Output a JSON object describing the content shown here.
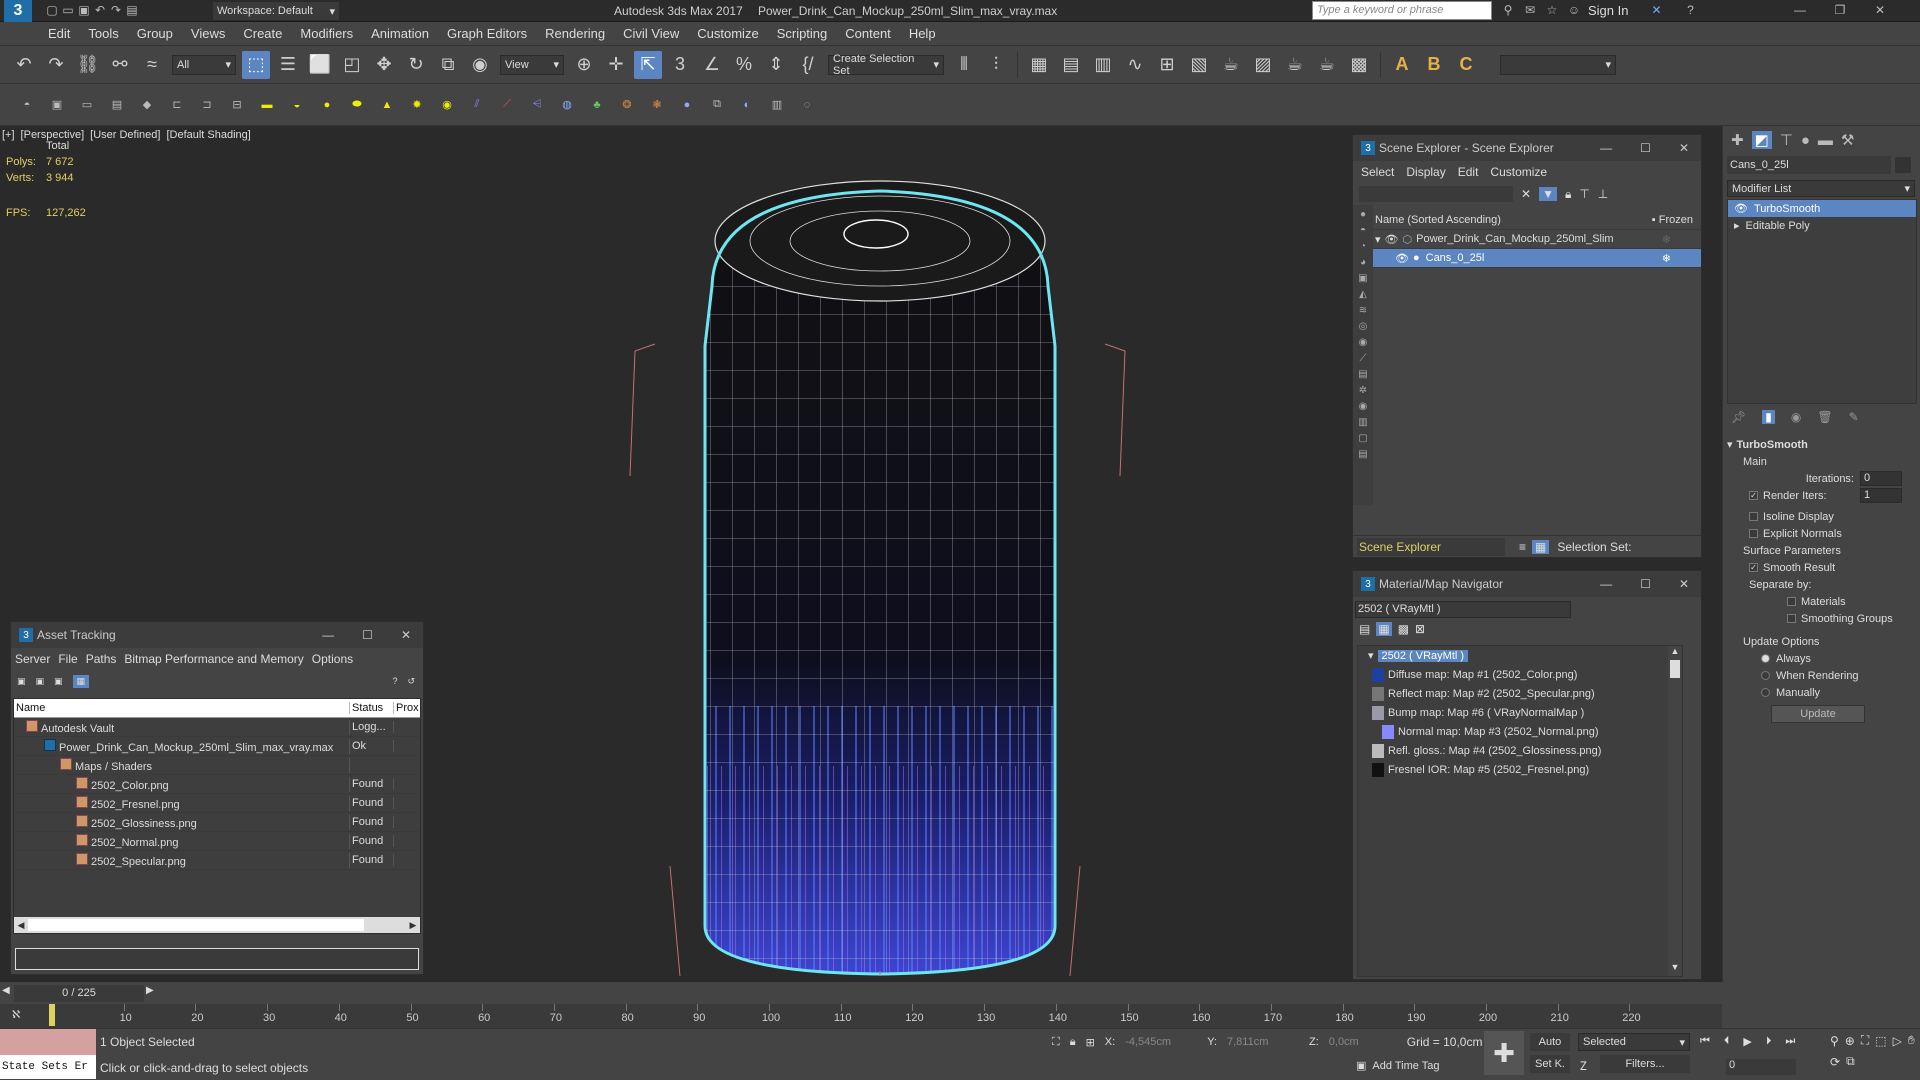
{
  "app": {
    "title": "Autodesk 3ds Max 2017",
    "file": "Power_Drink_Can_Mockup_250ml_Slim_max_vray.max",
    "workspace": "Workspace: Default",
    "search_placeholder": "Type a keyword or phrase",
    "sign_in": "Sign In"
  },
  "menu": [
    "Edit",
    "Tools",
    "Group",
    "Views",
    "Create",
    "Modifiers",
    "Animation",
    "Graph Editors",
    "Rendering",
    "Civil View",
    "Customize",
    "Scripting",
    "Content",
    "Help"
  ],
  "toolbar": {
    "filter": "All",
    "ref_coord": "View",
    "selection_set": "Create Selection Set"
  },
  "viewport": {
    "label_plus": "[+]",
    "label_view": "[Perspective]",
    "label_user": "[User Defined]",
    "label_shading": "[Default Shading]",
    "stats_total": "Total",
    "polys_label": "Polys:",
    "polys_value": "7 672",
    "verts_label": "Verts:",
    "verts_value": "3 944",
    "fps_label": "FPS:",
    "fps_value": "127,262"
  },
  "scene_explorer": {
    "title": "Scene Explorer - Scene Explorer",
    "menu": [
      "Select",
      "Display",
      "Edit",
      "Customize"
    ],
    "col_name": "Name (Sorted Ascending)",
    "col_frozen": "▪ Frozen",
    "items": [
      "Power_Drink_Can_Mockup_250ml_Slim",
      "Cans_0_25l"
    ],
    "footer_left": "Scene Explorer",
    "footer_right": "Selection Set:"
  },
  "material_nav": {
    "title": "Material/Map Navigator",
    "field": "2502  ( VRayMtl )",
    "root": "2502  ( VRayMtl )",
    "items": [
      "Diffuse map: Map #1 (2502_Color.png)",
      "Reflect map: Map #2 (2502_Specular.png)",
      "Bump map: Map #6  ( VRayNormalMap )",
      "Normal map: Map #3 (2502_Normal.png)",
      "Refl. gloss.: Map #4 (2502_Glossiness.png)",
      "Fresnel IOR: Map #5 (2502_Fresnel.png)"
    ]
  },
  "asset_tracking": {
    "title": "Asset Tracking",
    "menu": [
      "Server",
      "File",
      "Paths",
      "Bitmap Performance and Memory",
      "Options"
    ],
    "col_name": "Name",
    "col_status": "Status",
    "col_prox": "Prox",
    "rows": [
      {
        "name": "Autodesk Vault",
        "status": "Logg..."
      },
      {
        "name": "Power_Drink_Can_Mockup_250ml_Slim_max_vray.max",
        "status": "Ok"
      },
      {
        "name": "Maps / Shaders",
        "status": ""
      },
      {
        "name": "2502_Color.png",
        "status": "Found"
      },
      {
        "name": "2502_Fresnel.png",
        "status": "Found"
      },
      {
        "name": "2502_Glossiness.png",
        "status": "Found"
      },
      {
        "name": "2502_Normal.png",
        "status": "Found"
      },
      {
        "name": "2502_Specular.png",
        "status": "Found"
      }
    ]
  },
  "command_panel": {
    "object_name": "Cans_0_25l",
    "modifier_list": "Modifier List",
    "stack": [
      "TurboSmooth",
      "Editable Poly"
    ],
    "rollout": "TurboSmooth",
    "main": "Main",
    "iterations_label": "Iterations:",
    "iterations_value": "0",
    "render_iters_label": "Render Iters:",
    "render_iters_value": "1",
    "isoline": "Isoline Display",
    "explicit": "Explicit Normals",
    "surface_params": "Surface Parameters",
    "smooth_result": "Smooth Result",
    "separate_by": "Separate by:",
    "materials": "Materials",
    "smoothing_groups": "Smoothing Groups",
    "update_options": "Update Options",
    "always": "Always",
    "when_rendering": "When Rendering",
    "manually": "Manually",
    "update_btn": "Update"
  },
  "timeline": {
    "frame": "0 / 225",
    "ticks": [
      "10",
      "20",
      "30",
      "40",
      "50",
      "60",
      "70",
      "80",
      "90",
      "100",
      "110",
      "120",
      "130",
      "140",
      "150",
      "160",
      "170",
      "180",
      "190",
      "200",
      "210",
      "220"
    ]
  },
  "status": {
    "selected": "1 Object Selected",
    "prompt": "Click or click-and-drag to select objects",
    "state_sets": "State Sets Er",
    "x_label": "X:",
    "x_value": "-4,545cm",
    "y_label": "Y:",
    "y_value": "7,811cm",
    "z_label": "Z:",
    "z_value": "0,0cm",
    "grid": "Grid = 10,0cm",
    "add_time_tag": "Add Time Tag",
    "auto": "Auto",
    "set_k": "Set K.",
    "selected_combo": "Selected",
    "filters": "Filters...",
    "frame_field": "0"
  }
}
